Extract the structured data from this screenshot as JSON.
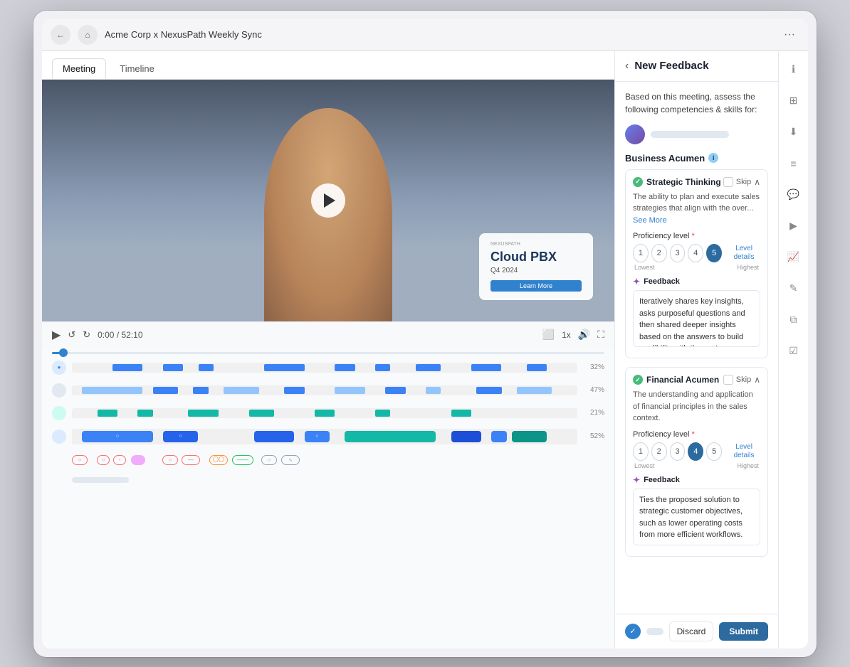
{
  "browser": {
    "title": "Acme Corp x NexusPath Weekly Sync",
    "more_label": "···"
  },
  "tabs": [
    {
      "id": "meeting",
      "label": "Meeting",
      "active": true
    },
    {
      "id": "timeline",
      "label": "Timeline",
      "active": false
    }
  ],
  "video": {
    "time_current": "0:00",
    "time_total": "52:10",
    "speed": "1x",
    "slide": {
      "logo": "NEXUSPATH",
      "title": "Cloud PBX",
      "subtitle": "Q4 2024"
    }
  },
  "tracks": [
    {
      "pct": "32%",
      "color": "#3b82f6"
    },
    {
      "pct": "47%",
      "color": "#3b82f6"
    },
    {
      "pct": "21%",
      "color": "#14b8a6"
    },
    {
      "pct": "52%",
      "color": "#3b82f6"
    }
  ],
  "panel": {
    "title": "New Feedback",
    "description": "Based on this meeting, assess the following competencies & skills for:",
    "section_label": "Business Acumen",
    "competencies": [
      {
        "id": "strategic_thinking",
        "title": "Strategic Thinking",
        "skip_label": "Skip",
        "description": "The ability to plan and execute sales strategies that align with the over...",
        "see_more_label": "See More",
        "proficiency_label": "Proficiency level",
        "levels": [
          1,
          2,
          3,
          4,
          5
        ],
        "active_level": 5,
        "lowest_label": "Lowest",
        "highest_label": "Highest",
        "level_details_label": "Level details",
        "feedback_header": "Feedback",
        "feedback_text": "Iteratively shares key insights, asks purposeful questions and then shared deeper insights based on the answers to build credibility with the customer."
      },
      {
        "id": "financial_acumen",
        "title": "Financial Acumen",
        "skip_label": "Skip",
        "description": "The understanding and application of financial principles in the sales context.",
        "proficiency_label": "Proficiency level",
        "levels": [
          1,
          2,
          3,
          4,
          5
        ],
        "active_level": 4,
        "lowest_label": "Lowest",
        "highest_label": "Highest",
        "level_details_label": "Level details",
        "feedback_header": "Feedback",
        "feedback_text": "Ties the proposed solution to strategic customer objectives, such as lower operating costs from more efficient workflows."
      }
    ],
    "footer": {
      "discard_label": "Discard",
      "submit_label": "Submit"
    }
  },
  "sidebar_icons": [
    {
      "name": "info-icon",
      "symbol": "ℹ"
    },
    {
      "name": "grid-icon",
      "symbol": "⊞"
    },
    {
      "name": "download-icon",
      "symbol": "⬇"
    },
    {
      "name": "document-icon",
      "symbol": "≡"
    },
    {
      "name": "chat-icon",
      "symbol": "💬"
    },
    {
      "name": "arrow-right-icon",
      "symbol": "▶"
    },
    {
      "name": "chart-icon",
      "symbol": "📈"
    },
    {
      "name": "edit-icon",
      "symbol": "✎"
    },
    {
      "name": "layers-icon",
      "symbol": "⧉"
    },
    {
      "name": "check-square-icon",
      "symbol": "☑"
    }
  ]
}
